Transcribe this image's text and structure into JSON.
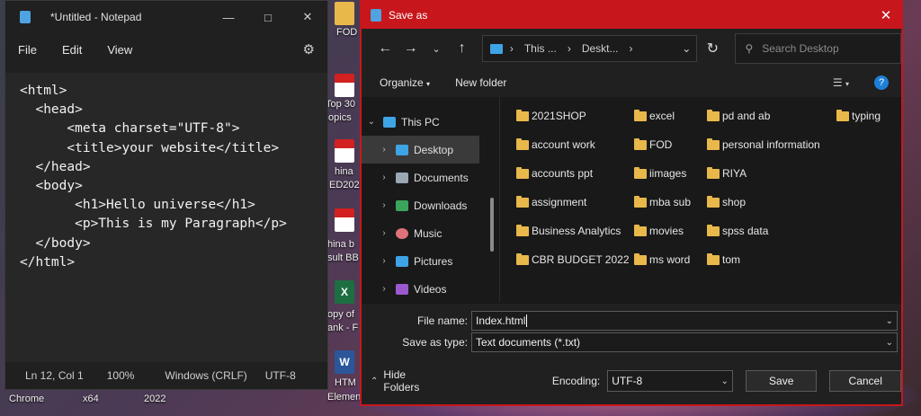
{
  "desktop": {
    "labels": [
      "FOD",
      "Top 30",
      "topics",
      "hina",
      "ED202",
      "hina b",
      "sult BB",
      "opy of",
      "ank - F",
      "HTM",
      "Elemen",
      "Chrome",
      "x64",
      "2022"
    ]
  },
  "notepad": {
    "title": "*Untitled - Notepad",
    "menu": [
      "File",
      "Edit",
      "View"
    ],
    "code": [
      "<html>",
      "  <head>",
      "      <meta charset=\"UTF-8\">",
      "",
      "      <title>your website</title>",
      "  </head>",
      "  <body>",
      "       <h1>Hello universe</h1>",
      "       <p>This is my Paragraph</p>",
      "  </body>",
      "</html>"
    ],
    "status": {
      "position": "Ln 12, Col 1",
      "zoom": "100%",
      "line_endings": "Windows (CRLF)",
      "encoding": "UTF-8"
    }
  },
  "dialog": {
    "title": "Save as",
    "address": [
      "This ...",
      "Deskt..."
    ],
    "search_placeholder": "Search Desktop",
    "toolbar": {
      "organize": "Organize",
      "new_folder": "New folder"
    },
    "nav": [
      {
        "label": "This PC",
        "color": "#3ea4e6"
      },
      {
        "label": "Desktop",
        "color": "#3ea4e6"
      },
      {
        "label": "Documents",
        "color": "#9aa7b5"
      },
      {
        "label": "Downloads",
        "color": "#3aa55b"
      },
      {
        "label": "Music",
        "color": "#e0727a"
      },
      {
        "label": "Pictures",
        "color": "#3ea4e6"
      },
      {
        "label": "Videos",
        "color": "#9b59d0"
      }
    ],
    "files": [
      "2021SHOP",
      "account work",
      "accounts ppt",
      "assignment",
      "Business Analytics",
      "CBR BUDGET 2022",
      "excel",
      "FOD",
      "iimages",
      "mba sub",
      "movies",
      "ms word",
      "pd and ab",
      "personal information",
      "RIYA",
      "shop",
      "spss data",
      "tom",
      "typing"
    ],
    "form": {
      "file_name_label": "File name:",
      "file_name_value": "Index.html",
      "save_type_label": "Save as type:",
      "save_type_value": "Text documents (*.txt)"
    },
    "footer": {
      "hide_folders": "Hide Folders",
      "encoding_label": "Encoding:",
      "encoding_value": "UTF-8",
      "save": "Save",
      "cancel": "Cancel"
    },
    "accent": "#c7171c"
  }
}
